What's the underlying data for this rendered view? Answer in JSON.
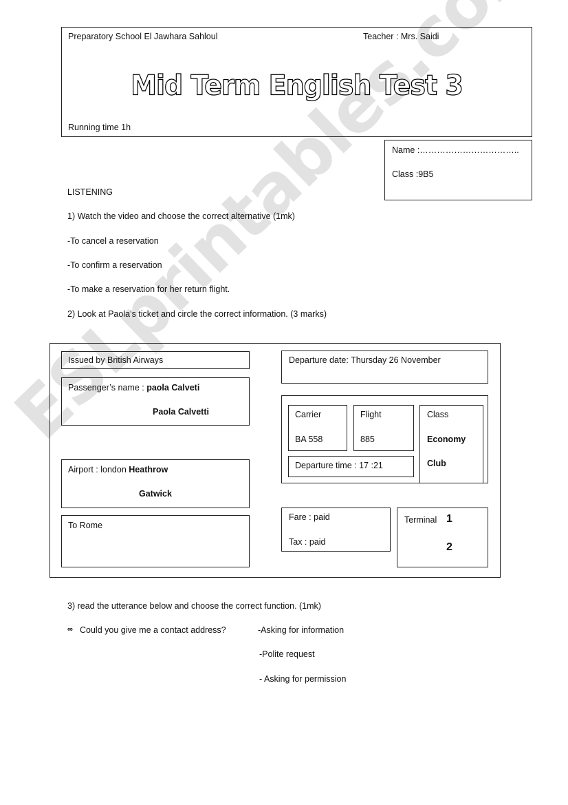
{
  "header": {
    "school": "Preparatory School El Jawhara Sahloul",
    "teacher": "Teacher :  Mrs. Saidi",
    "title": "Mid Term English Test 3",
    "running_time": "Running time 1h"
  },
  "student": {
    "name": "Name :……………………………..",
    "class": "Class :9B5"
  },
  "listening": {
    "heading": "LISTENING",
    "q1": "1) Watch the video and choose the correct alternative (1mk)",
    "q1_options": [
      "-To cancel a reservation",
      "-To confirm  a reservation",
      "-To make a reservation for her return flight."
    ],
    "q2": "2) Look at Paola’s ticket and circle the correct information. (3 marks)"
  },
  "ticket": {
    "issued": "Issued by British Airways",
    "passenger_label": "Passenger’s name :",
    "passenger_opt1": "paola Calveti",
    "passenger_opt2": "Paola Calvetti",
    "airport_label": "Airport : london",
    "airport_opt1": "Heathrow",
    "airport_opt2": "Gatwick",
    "to": "To  Rome",
    "departure_date": "Departure date:   Thursday 26 November",
    "carrier_label": "Carrier",
    "carrier_value": "BA 558",
    "flight_label": "Flight",
    "flight_value": "885",
    "class_label": "Class",
    "class_opt1": "Economy",
    "class_opt2": "Club",
    "departure_time": "Departure time : 17 :21",
    "fare": "Fare : paid",
    "tax": "Tax : paid",
    "terminal_label": "Terminal",
    "terminal_opt1": "1",
    "terminal_opt2": "2"
  },
  "q3": {
    "question": "3) read the utterance below and choose the correct function. (1mk)",
    "bullet_icon": "ornament-bullet-icon",
    "utterance": "Could you give me a contact address?",
    "options": [
      "-Asking for information",
      "-Polite request",
      "- Asking for permission"
    ]
  },
  "watermark": "ESLprintables.com"
}
